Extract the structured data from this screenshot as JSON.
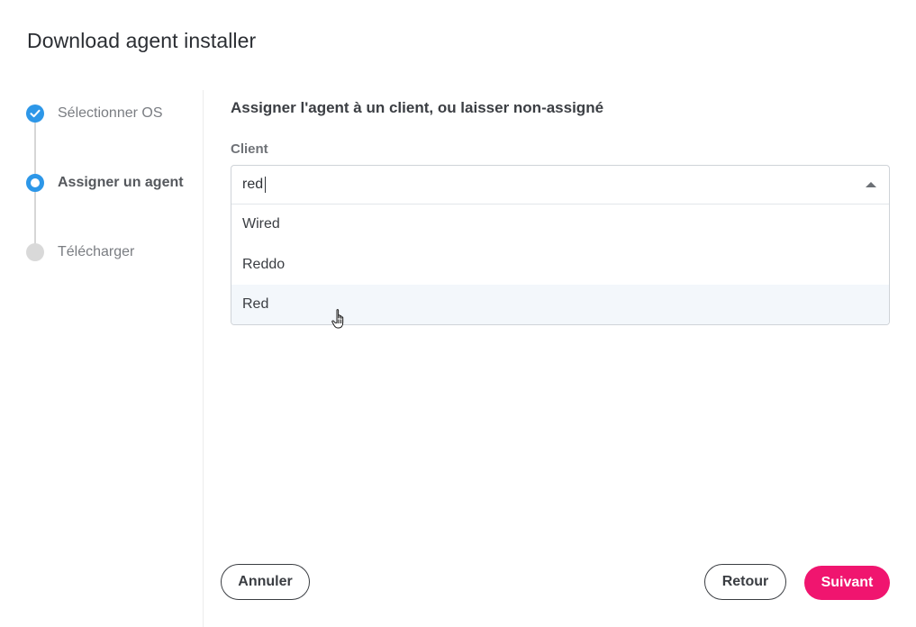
{
  "dialog": {
    "title": "Download agent installer"
  },
  "stepper": {
    "steps": [
      {
        "label": "Sélectionner OS",
        "state": "done"
      },
      {
        "label": "Assigner un agent",
        "state": "active"
      },
      {
        "label": "Télécharger",
        "state": "todo"
      }
    ]
  },
  "main": {
    "heading": "Assigner l'agent à un client, ou laisser non-assigné",
    "client_label": "Client",
    "client_input_value": "red",
    "options": [
      {
        "label": "Wired"
      },
      {
        "label": "Reddo"
      },
      {
        "label": "Red"
      }
    ]
  },
  "footer": {
    "cancel_label": "Annuler",
    "back_label": "Retour",
    "next_label": "Suivant"
  },
  "colors": {
    "accent": "#2d97e8",
    "primary_button": "#f0156f",
    "hover_row": "#f3f7fb"
  },
  "icons": {
    "step_done": "check-circle-icon",
    "step_active": "ring-icon",
    "step_todo": "dot-icon",
    "dropdown": "caret-up-icon",
    "mouse": "hand-pointer-icon"
  }
}
